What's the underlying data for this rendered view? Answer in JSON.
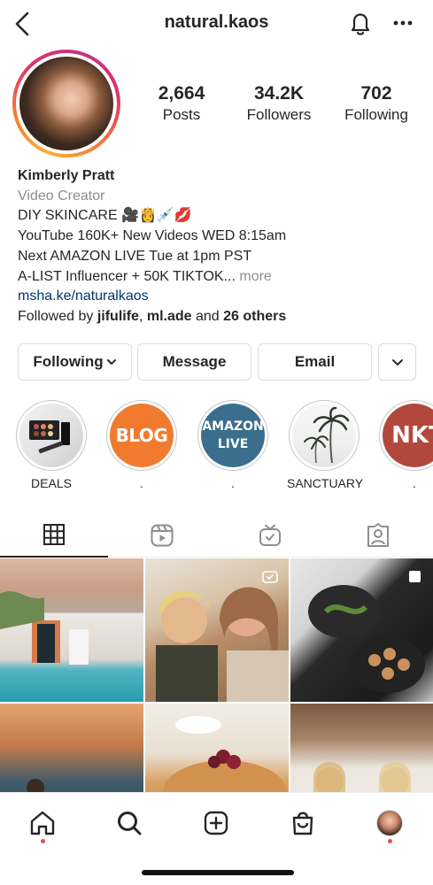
{
  "header": {
    "username": "natural.kaos",
    "icons": [
      "back-arrow-icon",
      "bell-icon",
      "more-icon"
    ]
  },
  "stats": [
    {
      "value": "2,664",
      "label": "Posts"
    },
    {
      "value": "34.2K",
      "label": "Followers"
    },
    {
      "value": "702",
      "label": "Following"
    }
  ],
  "bio": {
    "name": "Kimberly Pratt",
    "category": "Video Creator",
    "line1": "DIY SKINCARE 🎥👸💉💋",
    "line2": "YouTube 160K+ New Videos WED 8:15am",
    "line3": "Next AMAZON LIVE Tue at 1pm PST",
    "line4": "A-LIST Influencer + 50K TIKTOK...",
    "more": "more",
    "link": "msha.ke/naturalkaos",
    "followed_by_prefix": "Followed by",
    "followed_user1": "jifulife",
    "followed_sep": ",",
    "followed_user2": "ml.ade",
    "followed_and": "and",
    "followed_others": "26 others"
  },
  "actions": {
    "following": "Following",
    "message": "Message",
    "email": "Email"
  },
  "highlights": [
    {
      "label": "DEALS",
      "text": ""
    },
    {
      "label": ".",
      "text": "BLOG"
    },
    {
      "label": ".",
      "text_line1": "AMAZON",
      "text_line2": "LIVE"
    },
    {
      "label": "SANCTUARY",
      "text": ""
    },
    {
      "label": ".",
      "text": "NKT"
    }
  ],
  "tabs": [
    "grid-icon",
    "reels-icon",
    "igtv-icon",
    "tagged-icon"
  ],
  "bottom_nav": [
    "home-icon",
    "search-icon",
    "new-post-icon",
    "shop-icon",
    "profile-avatar"
  ],
  "colors": {
    "accent_link": "#00376b",
    "notification_dot": "#ed4956",
    "muted": "#8e8e8e"
  }
}
